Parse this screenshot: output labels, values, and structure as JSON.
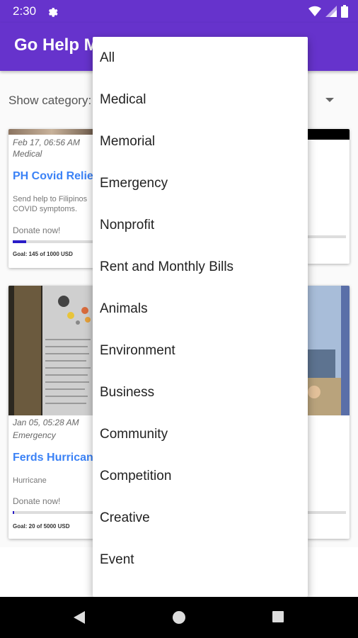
{
  "status_bar": {
    "time": "2:30"
  },
  "app_bar": {
    "title": "Go Help M"
  },
  "filter": {
    "label": "Show category:"
  },
  "cards": [
    {
      "date": "Feb 17, 06:56 AM",
      "category": "Medical",
      "title": "PH Covid Relie",
      "description": "Send help to Filipinos COVID symptoms.",
      "donate_label": "Donate now!",
      "progress": 0.145,
      "goal_text": "Goal: 145 of 1000 USD"
    },
    {
      "date": "Jan 05, 05:28 AM",
      "category": "Emergency",
      "title": "Ferds Hurrican",
      "description": "Hurricane",
      "donate_label": "Donate now!",
      "progress": 0.004,
      "goal_text": "Goal: 20 of 5000 USD"
    }
  ],
  "dropdown": {
    "items": [
      "All",
      "Medical",
      "Memorial",
      "Emergency",
      "Nonprofit",
      "Rent and Monthly Bills",
      "Animals",
      "Environment",
      "Business",
      "Community",
      "Competition",
      "Creative",
      "Event"
    ]
  },
  "colors": {
    "primary": "#6633cc",
    "link": "#3b82f6",
    "progress": "#2a1cc7"
  }
}
